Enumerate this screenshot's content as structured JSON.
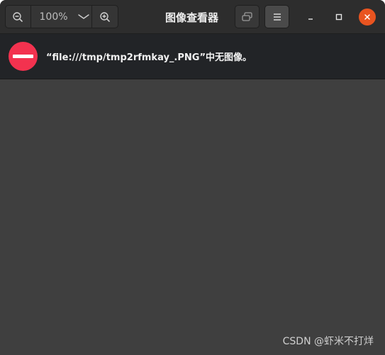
{
  "header": {
    "zoom_level": "100%",
    "title": "图像查看器"
  },
  "error": {
    "message": "“file:///tmp/tmp2rfmkay_.PNG”中无图像。"
  },
  "watermark": "CSDN @虾米不打烊",
  "colors": {
    "headerbar": "#2d2d2d",
    "errorbar": "#222427",
    "content": "#3f3f3f",
    "error_icon": "#f3324f",
    "close_button": "#e95420"
  },
  "icons": {
    "zoom_out": "zoom-out-icon",
    "zoom_dropdown": "chevron-down-icon",
    "zoom_in": "zoom-in-icon",
    "gallery": "gallery-icon",
    "menu": "hamburger-menu-icon",
    "minimize": "minimize-icon",
    "maximize": "maximize-icon",
    "close": "close-icon",
    "error": "no-entry-icon"
  }
}
